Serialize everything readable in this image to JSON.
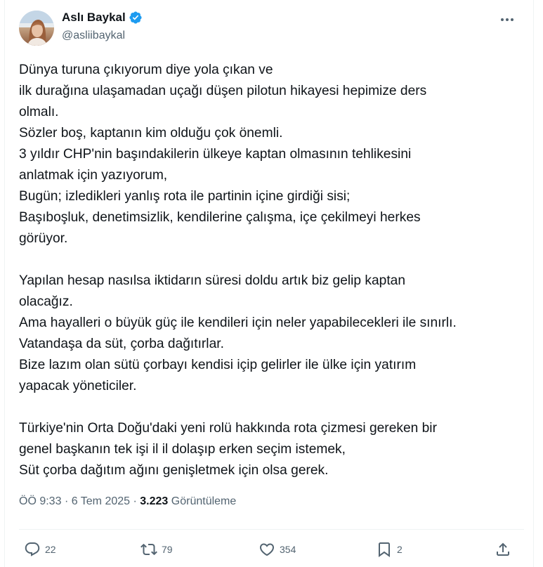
{
  "author": {
    "display_name": "Aslı Baykal",
    "handle": "@asliibaykal",
    "verified": true,
    "verified_color": "#1d9bf0"
  },
  "tweet": {
    "lines": [
      "Dünya turuna çıkıyorum diye yola çıkan ve",
      "ilk durağına ulaşamadan uçağı düşen pilotun hikayesi hepimize ders",
      "olmalı.",
      "Sözler boş, kaptanın kim olduğu çok önemli.",
      "3 yıldır CHP'nin başındakilerin ülkeye kaptan olmasının tehlikesini",
      "anlatmak için yazıyorum,",
      "Bugün; izledikleri yanlış rota ile partinin içine girdiği sisi;",
      "Başıboşluk, denetimsizlik, kendilerine çalışma, içe çekilmeyi herkes",
      "görüyor.",
      "",
      "Yapılan hesap nasılsa iktidarın süresi doldu artık biz gelip kaptan",
      "olacağız.",
      "Ama hayalleri o büyük güç ile kendileri için neler yapabilecekleri ile sınırlı.",
      "Vatandaşa da süt, çorba dağıtırlar.",
      "Bize lazım olan sütü çorbayı kendisi içip gelirler ile ülke için yatırım",
      "yapacak yöneticiler.",
      "",
      "Türkiye'nin Orta Doğu'daki yeni rolü hakkında rota çizmesi gereken bir",
      "genel başkanın tek işi il il dolaşıp erken seçim istemek,",
      "Süt çorba dağıtım ağını genişletmek için olsa gerek."
    ],
    "time": "ÖÖ 9:33",
    "separator": "·",
    "date": "6 Tem 2025",
    "views_count": "3.223",
    "views_label": "Görüntüleme"
  },
  "actions": {
    "reply_count": "22",
    "retweet_count": "79",
    "like_count": "354",
    "bookmark_count": "2"
  },
  "icons": {
    "more": "more-horizontal-icon",
    "reply": "speech-bubble-icon",
    "retweet": "retweet-arrows-icon",
    "like": "heart-icon",
    "bookmark": "bookmark-icon",
    "share": "share-upload-icon"
  },
  "colors": {
    "text": "#0f1419",
    "secondary": "#536471",
    "border": "#eff3f4"
  }
}
